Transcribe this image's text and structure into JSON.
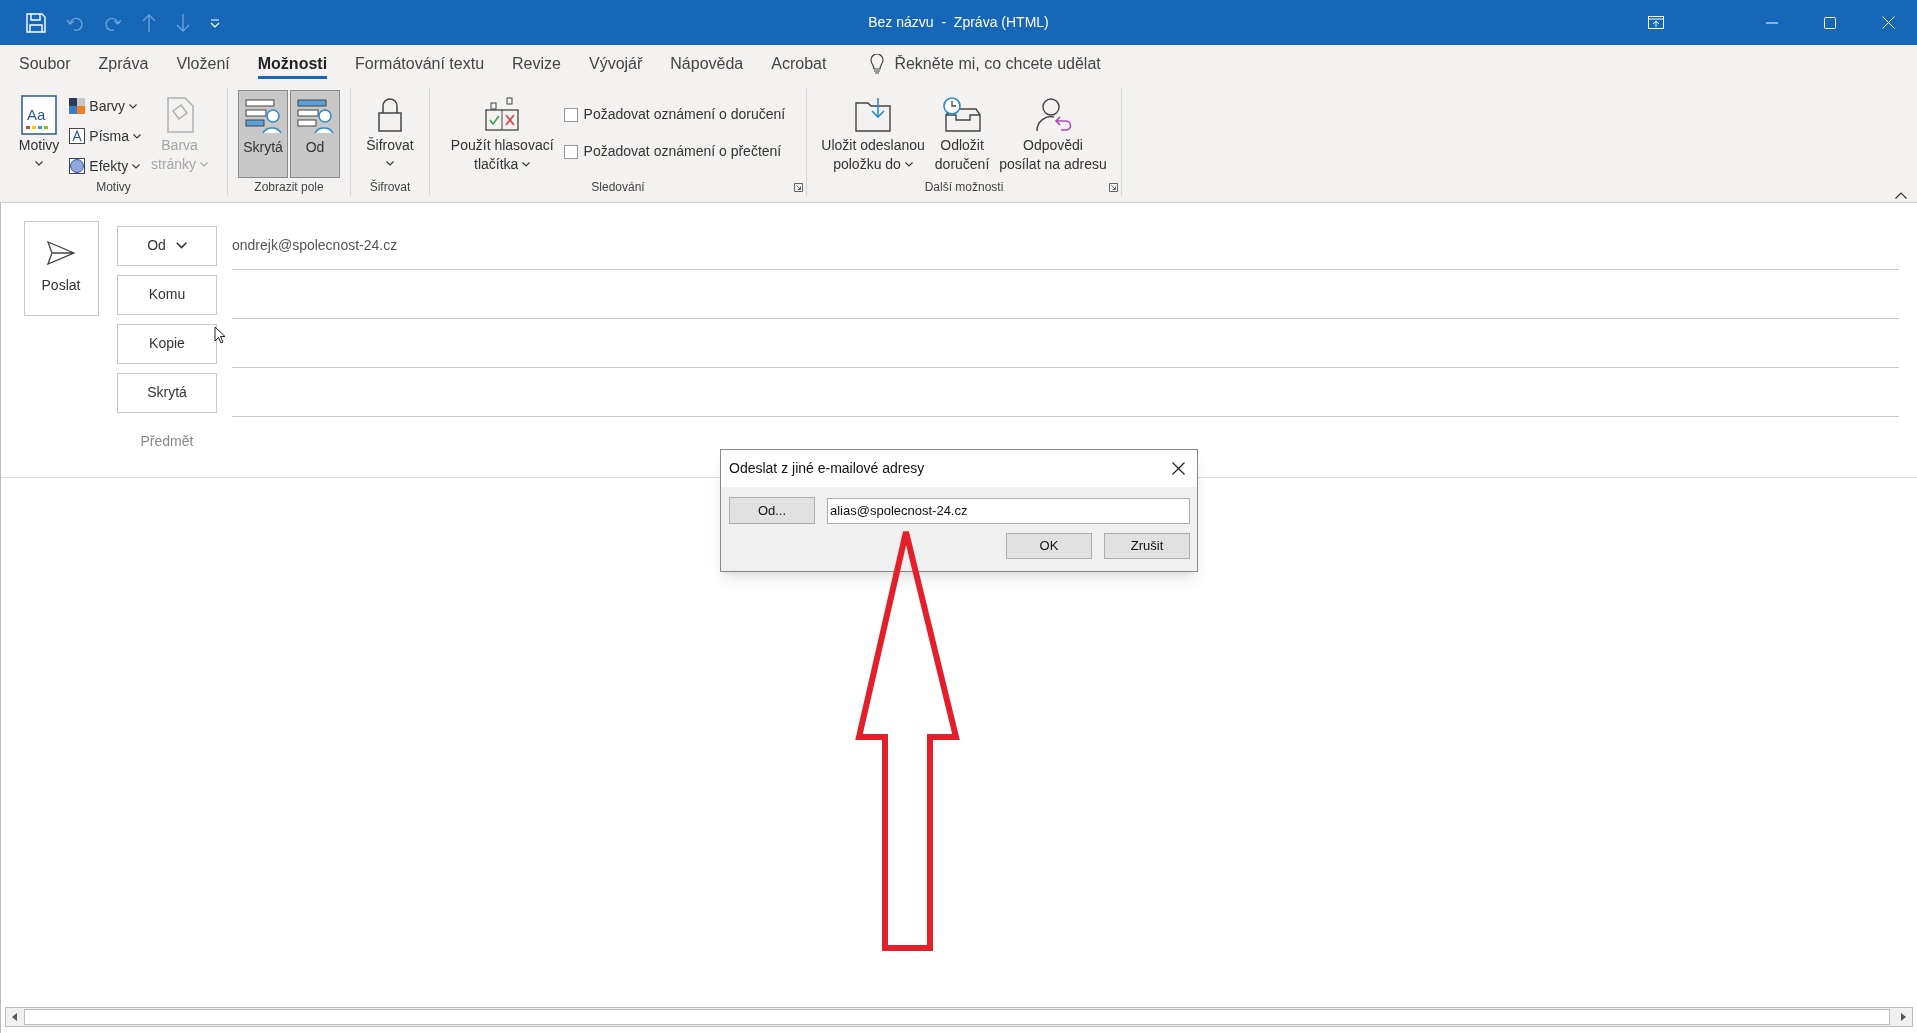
{
  "window": {
    "title": "Bez názvu  -  Zpráva (HTML)"
  },
  "ribbon_tabs": [
    {
      "label": "Soubor",
      "selected": false
    },
    {
      "label": "Zpráva",
      "selected": false
    },
    {
      "label": "Vložení",
      "selected": false
    },
    {
      "label": "Možnosti",
      "selected": true
    },
    {
      "label": "Formátování textu",
      "selected": false
    },
    {
      "label": "Revize",
      "selected": false
    },
    {
      "label": "Vývojář",
      "selected": false
    },
    {
      "label": "Nápověda",
      "selected": false
    },
    {
      "label": "Acrobat",
      "selected": false
    }
  ],
  "tell_me": {
    "placeholder": "Řekněte mi, co chcete udělat"
  },
  "ribbon_groups": [
    {
      "label": "Motivy",
      "launcher": false,
      "items": [
        {
          "kind": "large",
          "icon_text": "Aa",
          "lines": [
            "Motivy"
          ],
          "dropdown": true,
          "disabled": false
        },
        {
          "kind": "stack",
          "entries": [
            {
              "label": "Barvy",
              "dropdown": true
            },
            {
              "label": "Písma",
              "dropdown": true
            },
            {
              "label": "Efekty",
              "dropdown": true
            }
          ]
        },
        {
          "kind": "large",
          "lines": [
            "Barva",
            "stránky"
          ],
          "dropdown": true,
          "disabled": true
        }
      ]
    },
    {
      "label": "Zobrazit pole",
      "launcher": false,
      "items": [
        {
          "kind": "toggle",
          "label": "Skrytá",
          "on": true
        },
        {
          "kind": "toggle",
          "label": "Od",
          "on": true
        }
      ]
    },
    {
      "label": "Šifrovat",
      "launcher": false,
      "items": [
        {
          "kind": "large",
          "lines": [
            "Šifrovat"
          ],
          "dropdown": true,
          "disabled": false
        }
      ]
    },
    {
      "label": "Sledování",
      "launcher": true,
      "items": [
        {
          "kind": "large",
          "lines": [
            "Použít hlasovací",
            "tlačítka"
          ],
          "dropdown": true,
          "disabled": false
        },
        {
          "kind": "checks",
          "entries": [
            {
              "label": "Požadovat oznámení o doručení",
              "checked": false
            },
            {
              "label": "Požadovat oznámení o přečtení",
              "checked": false
            }
          ]
        }
      ]
    },
    {
      "label": "Další možnosti",
      "launcher": true,
      "items": [
        {
          "kind": "large",
          "lines": [
            "Uložit odeslanou",
            "položku do"
          ],
          "dropdown": true,
          "disabled": false
        },
        {
          "kind": "large",
          "lines": [
            "Odložit",
            "doručení"
          ],
          "dropdown": false,
          "disabled": false
        },
        {
          "kind": "large",
          "lines": [
            "Odpovědi",
            "posílat na adresu"
          ],
          "dropdown": false,
          "disabled": false
        }
      ]
    }
  ],
  "compose": {
    "send_button": "Poslat",
    "fields": [
      {
        "label": "Od",
        "dropdown": true,
        "value": "ondrejk@spolecnost-24.cz"
      },
      {
        "label": "Komu",
        "dropdown": false
      },
      {
        "label": "Kopie",
        "dropdown": false
      },
      {
        "label": "Skrytá",
        "dropdown": false
      }
    ],
    "subject": {
      "label": "Předmět"
    }
  },
  "dialog": {
    "title": "Odeslat z jiné e-mailové adresy",
    "from_button": "Od...",
    "address": "alias@spolecnost-24.cz",
    "buttons": [
      "OK",
      "Zrušit"
    ]
  }
}
